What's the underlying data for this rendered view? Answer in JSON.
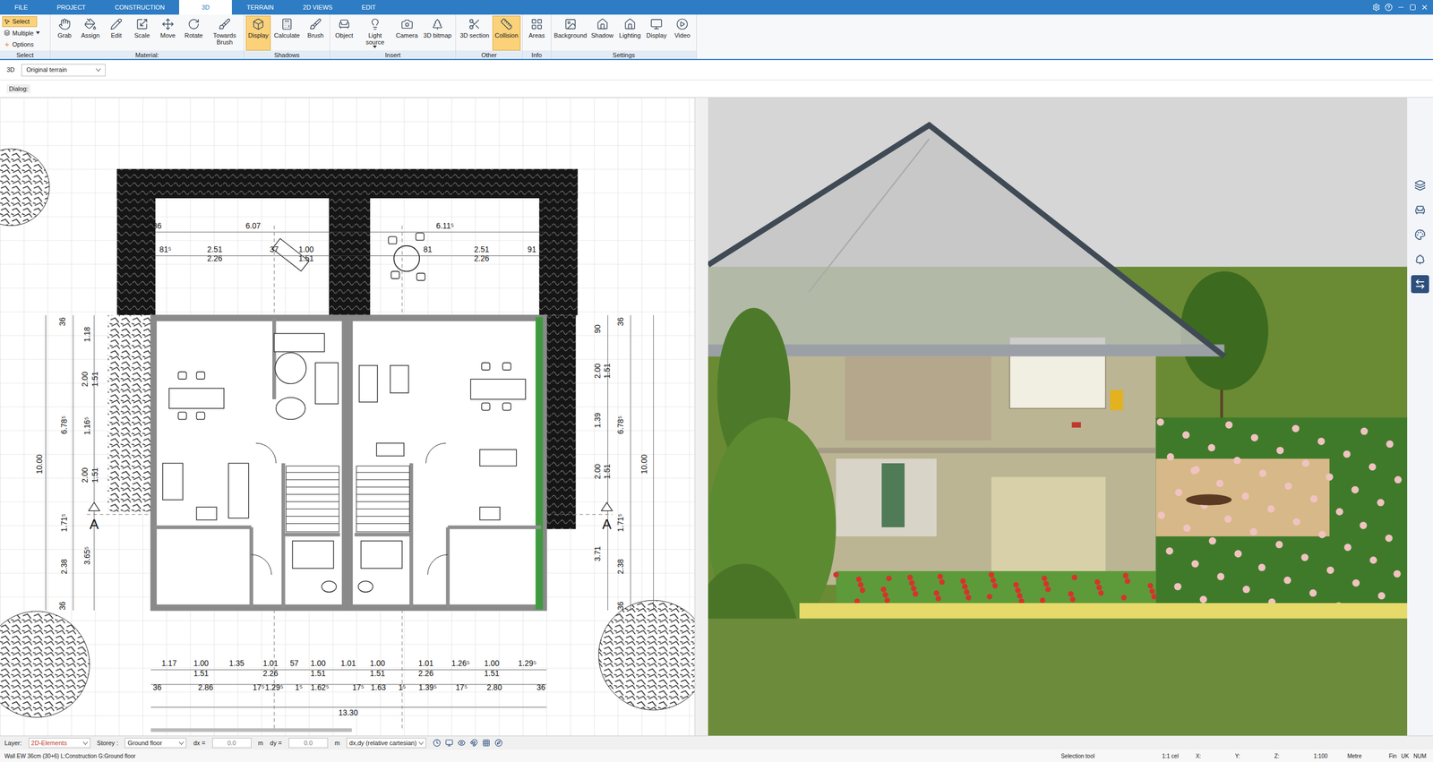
{
  "tabs": [
    {
      "label": "FILE",
      "selected": false
    },
    {
      "label": "PROJECT",
      "selected": false
    },
    {
      "label": "CONSTRUCTION",
      "selected": false
    },
    {
      "label": "3D",
      "selected": true
    },
    {
      "label": "TERRAIN",
      "selected": false
    },
    {
      "label": "2D VIEWS",
      "selected": false
    },
    {
      "label": "EDIT",
      "selected": false
    }
  ],
  "ribbon": {
    "select_group": {
      "label": "Select",
      "items": [
        {
          "label": "Select",
          "selected": true
        },
        {
          "label": "Multiple",
          "selected": false
        },
        {
          "label": "Options",
          "selected": false
        }
      ]
    },
    "groups": [
      {
        "label": "Material:",
        "items": [
          {
            "label": "Grab",
            "active": false,
            "has_menu": false
          },
          {
            "label": "Assign",
            "active": false,
            "has_menu": false
          },
          {
            "label": "Edit",
            "active": false,
            "has_menu": false
          },
          {
            "label": "Scale",
            "active": false,
            "has_menu": false
          },
          {
            "label": "Move",
            "active": false,
            "has_menu": false
          },
          {
            "label": "Rotate",
            "active": false,
            "has_menu": false
          },
          {
            "label": "Towards Brush",
            "active": false,
            "has_menu": false
          }
        ]
      },
      {
        "label": "Shadows",
        "items": [
          {
            "label": "Display",
            "active": true,
            "has_menu": false
          },
          {
            "label": "Calculate",
            "active": false,
            "has_menu": false
          },
          {
            "label": "Brush",
            "active": false,
            "has_menu": false
          }
        ]
      },
      {
        "label": "Insert",
        "items": [
          {
            "label": "Object",
            "active": false,
            "has_menu": false
          },
          {
            "label": "Light source",
            "active": false,
            "has_menu": true
          },
          {
            "label": "Camera",
            "active": false,
            "has_menu": false
          },
          {
            "label": "3D bitmap",
            "active": false,
            "has_menu": false
          }
        ]
      },
      {
        "label": "Other",
        "items": [
          {
            "label": "3D section",
            "active": false,
            "has_menu": false
          },
          {
            "label": "Collision",
            "active": true,
            "has_menu": false
          }
        ]
      },
      {
        "label": "Info",
        "items": [
          {
            "label": "Areas",
            "active": false,
            "has_menu": false
          }
        ]
      },
      {
        "label": "Settings",
        "items": [
          {
            "label": "Background",
            "active": false,
            "has_menu": false
          },
          {
            "label": "Shadow",
            "active": false,
            "has_menu": false
          },
          {
            "label": "Lighting",
            "active": false,
            "has_menu": false
          },
          {
            "label": "Display",
            "active": false,
            "has_menu": false
          },
          {
            "label": "Video",
            "active": false,
            "has_menu": false
          }
        ]
      }
    ]
  },
  "view_row": {
    "label": "3D",
    "terrain": "Original terrain"
  },
  "dialog_label": "Dialog:",
  "plan": {
    "top": [
      "36",
      "6.07",
      "6.11⁵",
      "81⁵",
      "2.51",
      "2.26",
      "37",
      "1.00",
      "1.51",
      "81",
      "2.51",
      "2.26",
      "91"
    ],
    "left": [
      "36",
      "1.18",
      "2.00",
      "1.51",
      "6.78⁵",
      "1.16⁵",
      "10.00",
      "2.00",
      "1.51",
      "1.71⁵",
      "3.65⁵",
      "2.38",
      "36"
    ],
    "right": [
      "90",
      "36",
      "2.00",
      "1.51",
      "1.39",
      "6.78⁵",
      "10.00",
      "2.00",
      "1.51",
      "1.71⁵",
      "3.71",
      "2.38",
      "36"
    ],
    "bottom": [
      "1.17",
      "1.00",
      "1.35",
      "1.01",
      "57",
      "1.00",
      "1.01",
      "1.00",
      "1.01",
      "1.26⁵",
      "1.00",
      "1.29⁵",
      "1.51",
      "2.26",
      "1.51",
      "1.51",
      "2.26",
      "1.51",
      "36",
      "2.86",
      "17⁵",
      "1.29⁵",
      "1⁵",
      "1.62⁵",
      "17⁵",
      "1.63",
      "1⁵",
      "1.39⁵",
      "17⁵",
      "2.80",
      "36"
    ],
    "total": "13.30",
    "section_marks": [
      "A",
      "A"
    ]
  },
  "status": {
    "layer_label": "Layer:",
    "layer": "2D-Elements",
    "storey_label": "Storey :",
    "storey": "Ground floor",
    "dx_label": "dx =",
    "dx": "0.0",
    "dx_unit": "m",
    "dy_label": "dy =",
    "dy": "0.0",
    "dy_unit": "m",
    "coord_mode": "dx,dy (relative cartesian)"
  },
  "info_bar": {
    "message": "Wall EW 36cm (30+6)  L:Construction G:Ground floor",
    "tool": "Selection tool",
    "scale_cell": "1:1 cel",
    "x": "X:",
    "y": "Y:",
    "z": "Z:",
    "scale": "1:100",
    "unit": "Metre",
    "flags": [
      "Fin",
      "UK",
      "NUM"
    ]
  }
}
